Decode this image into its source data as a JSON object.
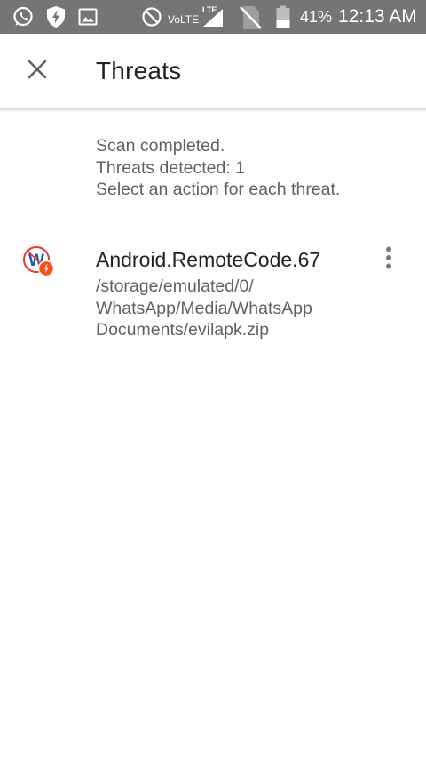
{
  "status_bar": {
    "network_label": "VoLTE",
    "lte_label": "LTE",
    "battery_percent": "41%",
    "battery_level": 0.41,
    "time": "12:13 AM",
    "icons": [
      "whatsapp-icon",
      "shield-bolt-icon",
      "image-icon",
      "do-not-disturb-icon",
      "signal-icon",
      "no-sim-icon",
      "battery-icon"
    ]
  },
  "header": {
    "close_icon": "close-icon",
    "title": "Threats"
  },
  "summary": {
    "line1": "Scan completed.",
    "line2": "Threats detected: 1",
    "line3": "Select an action for each threat."
  },
  "threats": [
    {
      "name": "Android.RemoteCode.67",
      "path_lines": [
        "/storage/emulated/0/",
        "WhatsApp/Media/WhatsApp",
        "Documents/evilapk.zip"
      ],
      "icon": "whatsapp-threat-icon",
      "menu_icon": "more-vert-icon"
    }
  ],
  "colors": {
    "status_bar": "#757575",
    "threat_badge": "#f4511e",
    "threat_ring": "#e53935",
    "whatsapp_w": "#1e5aa8"
  }
}
